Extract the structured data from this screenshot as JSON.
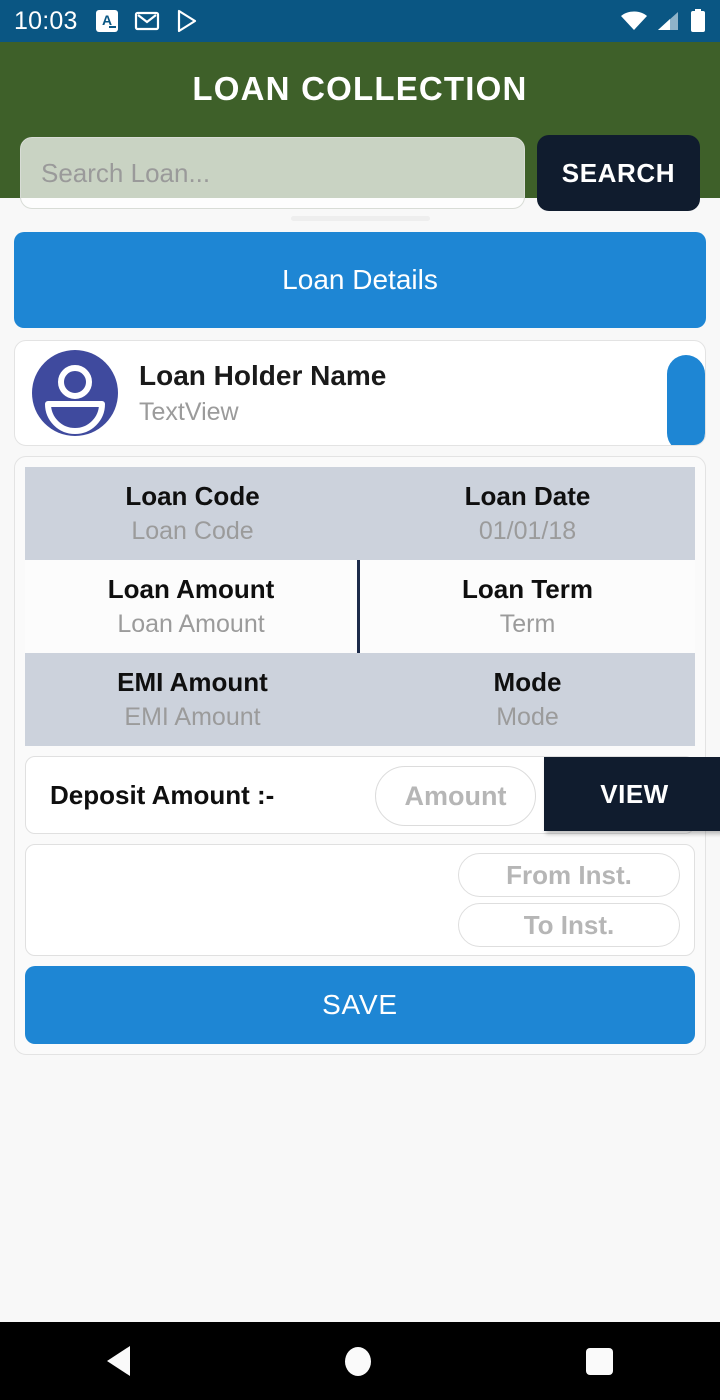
{
  "status_bar": {
    "time": "10:03",
    "left_icons": [
      "translate-icon",
      "gmail-icon",
      "play-store-icon"
    ],
    "right_icons": [
      "wifi-icon",
      "cell-signal-icon",
      "battery-icon"
    ],
    "background_color": "#0a5683"
  },
  "header": {
    "title": "LOAN COLLECTION",
    "background_color": "#3e6029"
  },
  "search": {
    "placeholder": "Search Loan...",
    "value": "",
    "button_label": "SEARCH",
    "button_color": "#101c2e"
  },
  "details_banner": {
    "label": "Loan Details",
    "color": "#1e86d4"
  },
  "holder": {
    "name": "Loan Holder Name",
    "subtitle": "TextView",
    "avatar_icon": "person-avatar-icon",
    "avatar_color": "#3f4a9e",
    "side_pill_color": "#1e86d4"
  },
  "grid": {
    "rows": [
      {
        "shaded": true,
        "cells": [
          {
            "label": "Loan Code",
            "value": "Loan Code"
          },
          {
            "label": "Loan Date",
            "value": "01/01/18"
          }
        ]
      },
      {
        "shaded": false,
        "cells": [
          {
            "label": "Loan Amount",
            "value": "Loan Amount"
          },
          {
            "label": "Loan Term",
            "value": "Term"
          }
        ]
      },
      {
        "shaded": true,
        "cells": [
          {
            "label": "EMI Amount",
            "value": "EMI Amount"
          },
          {
            "label": "Mode",
            "value": "Mode"
          }
        ]
      }
    ],
    "shaded_row_color": "#ccd2dc",
    "divider_color": "#1d2b4a"
  },
  "deposit": {
    "label": "Deposit Amount :-",
    "amount_placeholder": "Amount",
    "amount_value": "",
    "view_button_label": "VIEW"
  },
  "installments": {
    "from_placeholder": "From Inst.",
    "from_value": "",
    "to_placeholder": "To Inst.",
    "to_value": ""
  },
  "save": {
    "label": "SAVE",
    "color": "#1e86d4"
  },
  "nav_bar": {
    "back_icon": "back-triangle-icon",
    "home_icon": "home-circle-icon",
    "recents_icon": "recents-square-icon"
  }
}
